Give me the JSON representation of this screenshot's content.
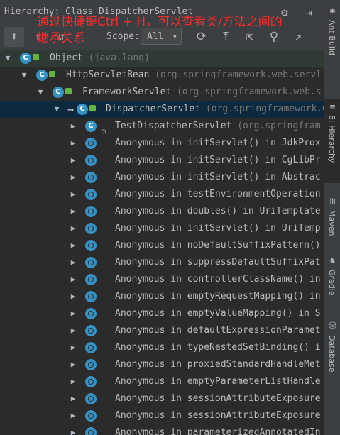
{
  "window": {
    "title": "Hierarchy: Class DispatcherServlet",
    "gear_icon": "gear-icon",
    "hide_icon": "hide-panel-icon"
  },
  "annotation": "通过快捷键Ctrl + H，可以查看类/方法之间的继承关系",
  "toolbar": {
    "tools": [
      "subtypes-hierarchy-icon",
      "supertypes-hierarchy-icon",
      "type-hierarchy-icon"
    ],
    "scope_label": "Scope:",
    "scope_value": "All",
    "actions": [
      "refresh-icon",
      "export-icon",
      "expand-all-icon",
      "pin-icon",
      "open-icon"
    ]
  },
  "tree": [
    {
      "name": "Object",
      "pkg": "(java.lang)"
    },
    {
      "name": "HttpServletBean",
      "pkg": "(org.springframework.web.servl"
    },
    {
      "name": "FrameworkServlet",
      "pkg": "(org.springframework.web.s"
    },
    {
      "name": "DispatcherServlet",
      "pkg": "(org.springframework.web."
    },
    {
      "name": "TestDispatcherServlet",
      "pkg": "(org.springfram"
    },
    {
      "name": "Anonymous in initServlet() in JdkProx"
    },
    {
      "name": "Anonymous in initServlet() in CgLibPr"
    },
    {
      "name": "Anonymous in initServlet() in Abstrac"
    },
    {
      "name": "Anonymous in testEnvironmentOperation"
    },
    {
      "name": "Anonymous in doubles() in UriTemplate"
    },
    {
      "name": "Anonymous in initServlet() in UriTemp"
    },
    {
      "name": "Anonymous in noDefaultSuffixPattern()"
    },
    {
      "name": "Anonymous in suppressDefaultSuffixPat"
    },
    {
      "name": "Anonymous in controllerClassName() in"
    },
    {
      "name": "Anonymous in emptyRequestMapping() in"
    },
    {
      "name": "Anonymous in emptyValueMapping() in S"
    },
    {
      "name": "Anonymous in defaultExpressionParamet"
    },
    {
      "name": "Anonymous in typeNestedSetBinding() i"
    },
    {
      "name": "Anonymous in proxiedStandardHandleMet"
    },
    {
      "name": "Anonymous in emptyParameterListHandle"
    },
    {
      "name": "Anonymous in sessionAttributeExposure"
    },
    {
      "name": "Anonymous in sessionAttributeExposure"
    },
    {
      "name": "Anonymous in parameterizedAnnotatedIn"
    }
  ],
  "sidebar": {
    "items": [
      {
        "label": "Ant Build"
      },
      {
        "label": "8: Hierarchy"
      },
      {
        "label": "Maven"
      },
      {
        "label": "Gradle"
      },
      {
        "label": "Database"
      }
    ]
  }
}
